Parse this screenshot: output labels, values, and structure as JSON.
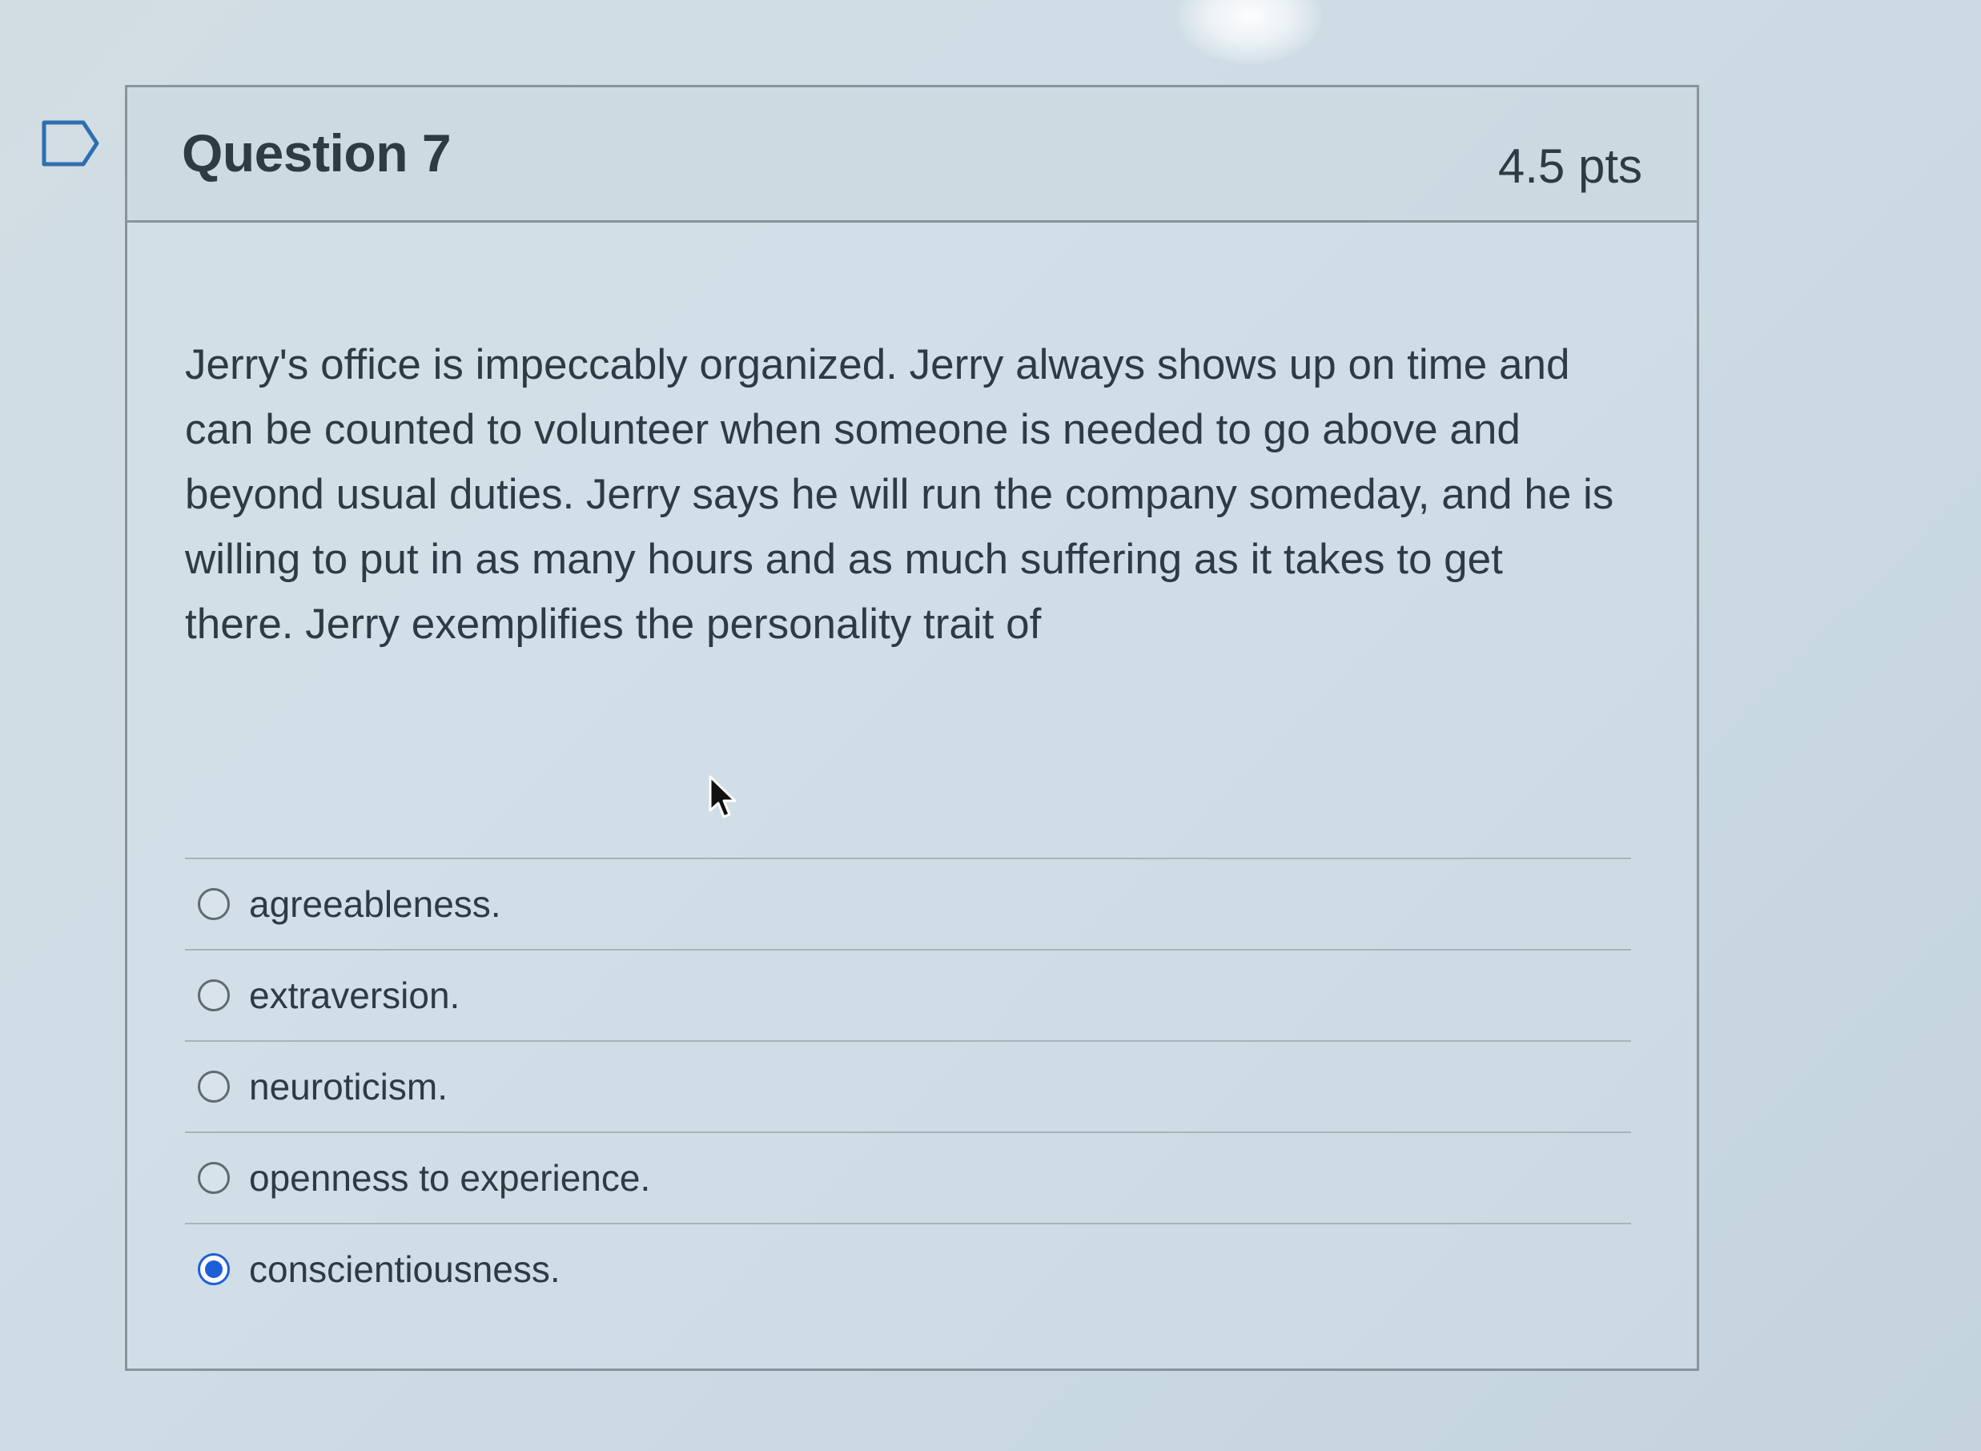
{
  "question": {
    "title": "Question 7",
    "points": "4.5 pts",
    "text": "Jerry's office is impeccably organized. Jerry always shows up on time and can be counted to volunteer when someone is needed to go above and beyond usual duties. Jerry says he will run the company someday, and he is willing to put in as many hours and as much suffering as it takes to get there. Jerry exemplifies the personality trait of",
    "answers": [
      {
        "label": "agreeableness.",
        "selected": false
      },
      {
        "label": "extraversion.",
        "selected": false
      },
      {
        "label": "neuroticism.",
        "selected": false
      },
      {
        "label": "openness to experience.",
        "selected": false
      },
      {
        "label": "conscientiousness.",
        "selected": true
      }
    ]
  },
  "colors": {
    "selected_radio": "#1f5fd6",
    "text": "#2d3b45",
    "border": "#8a9399"
  },
  "icons": {
    "flag": "bookmark-flag-icon",
    "cursor": "mouse-pointer-icon"
  }
}
